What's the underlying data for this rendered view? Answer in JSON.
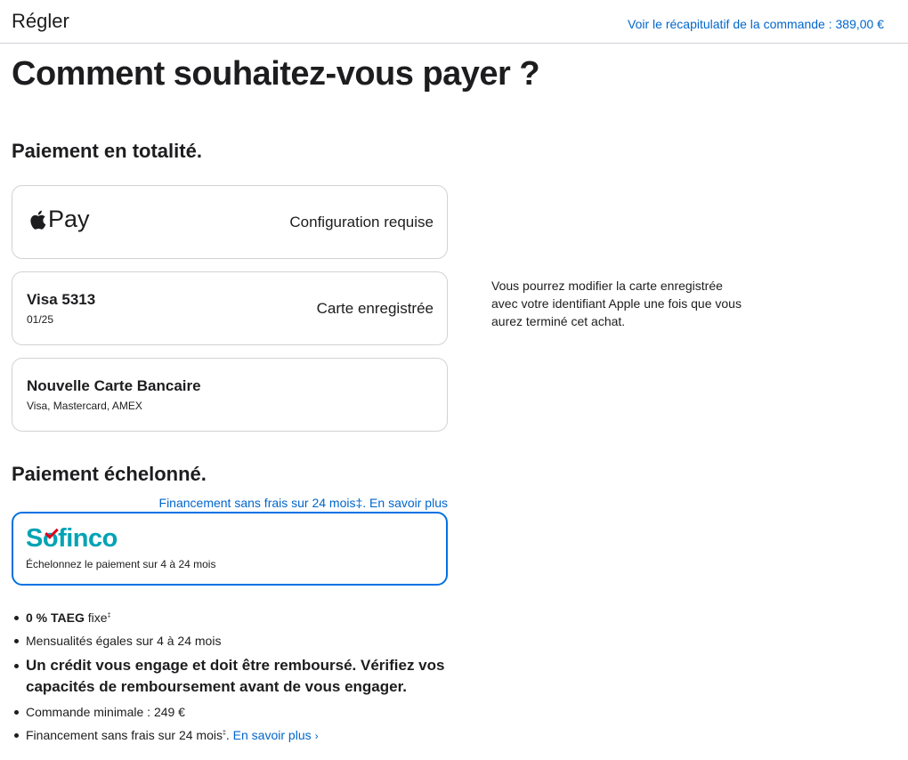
{
  "header": {
    "title": "Régler",
    "summary_link": "Voir le récapitulatif de la commande : 389,00 €"
  },
  "page_title": "Comment souhaitez-vous payer ?",
  "full_payment": {
    "title": "Paiement en totalité.",
    "apple_pay": {
      "label": "Pay",
      "status": "Configuration requise"
    },
    "visa": {
      "name": "Visa 5313",
      "expiry": "01/25",
      "status": "Carte enregistrée"
    },
    "new_card": {
      "name": "Nouvelle Carte Bancaire",
      "networks": "Visa, Mastercard, AMEX"
    }
  },
  "side_note": "Vous pourrez modifier la carte enregistrée avec votre identifiant Apple une fois que vous aurez terminé cet achat.",
  "installments": {
    "title": "Paiement échelonné.",
    "financing_link": "Financement sans frais sur 24 mois‡. En savoir plus",
    "sofinco": {
      "logo": "Sofinco",
      "logo_s": "S",
      "logo_rest": "finco",
      "description": "Échelonnez le paiement sur 4 à 24 mois"
    },
    "bullets": {
      "taeg_bold": "0 % TAEG",
      "taeg_rest": " fixe",
      "taeg_sup": "‡",
      "monthly": "Mensualités égales sur 4 à 24 mois",
      "warning": "Un crédit vous engage et doit être remboursé. Vérifiez vos capacités de remboursement avant de vous engager.",
      "minimum": "Commande minimale : 249 €",
      "financing_text": "Financement sans frais sur 24 mois",
      "financing_sup": "‡",
      "financing_after": ". ",
      "learn_more": "En savoir plus"
    }
  },
  "colors": {
    "link": "#0066cc",
    "selected_border": "#0071e3",
    "sofinco_teal": "#00a3b4",
    "sofinco_red": "#e2001a"
  }
}
